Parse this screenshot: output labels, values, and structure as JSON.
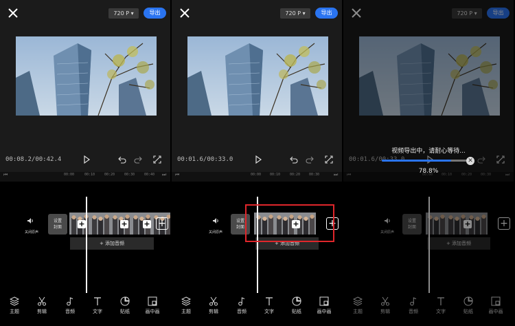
{
  "panels": [
    {
      "resolution": "720 P ▾",
      "export_label": "导出",
      "time": "00:08.2/00:42.4",
      "ruler": [
        "00:00",
        "00:10",
        "00:20",
        "00:30",
        "00:40"
      ],
      "mute_label": "关闭原声",
      "cover_label_1": "设置",
      "cover_label_2": "封面",
      "add_audio": "+ 添加音频",
      "speed_badges": [
        "1.0x",
        "1.0x",
        "1.0x"
      ]
    },
    {
      "resolution": "720 P ▾",
      "export_label": "导出",
      "time": "00:01.6/00:33.0",
      "ruler": [
        "00:00",
        "00:10",
        "00:20",
        "00:30"
      ],
      "mute_label": "关闭原声",
      "cover_label_1": "设置",
      "cover_label_2": "封面",
      "add_audio": "+ 添加音频",
      "speed_badges": [
        "1.0x",
        "1.0x"
      ]
    },
    {
      "resolution": "720 P ▾",
      "export_label": "导出",
      "time": "00:01.6/00:33.0",
      "ruler": [
        "00:00",
        "00:10",
        "00:20",
        "00:30"
      ],
      "mute_label": "关闭原声",
      "cover_label_1": "设置",
      "cover_label_2": "封面",
      "add_audio": "+ 添加音频",
      "export_message": "视频导出中，请耐心等待...",
      "export_progress_percent": "78.8%",
      "export_progress": 0.788
    }
  ],
  "tools": [
    {
      "label": "主题",
      "icon": "layers-icon"
    },
    {
      "label": "剪辑",
      "icon": "scissors-icon"
    },
    {
      "label": "音频",
      "icon": "music-note-icon"
    },
    {
      "label": "文字",
      "icon": "text-icon"
    },
    {
      "label": "贴纸",
      "icon": "sticker-icon"
    },
    {
      "label": "画中画",
      "icon": "picture-in-picture-icon"
    }
  ],
  "colors": {
    "accent": "#2a74f0",
    "highlight": "#e0262b",
    "background": "#000000"
  }
}
